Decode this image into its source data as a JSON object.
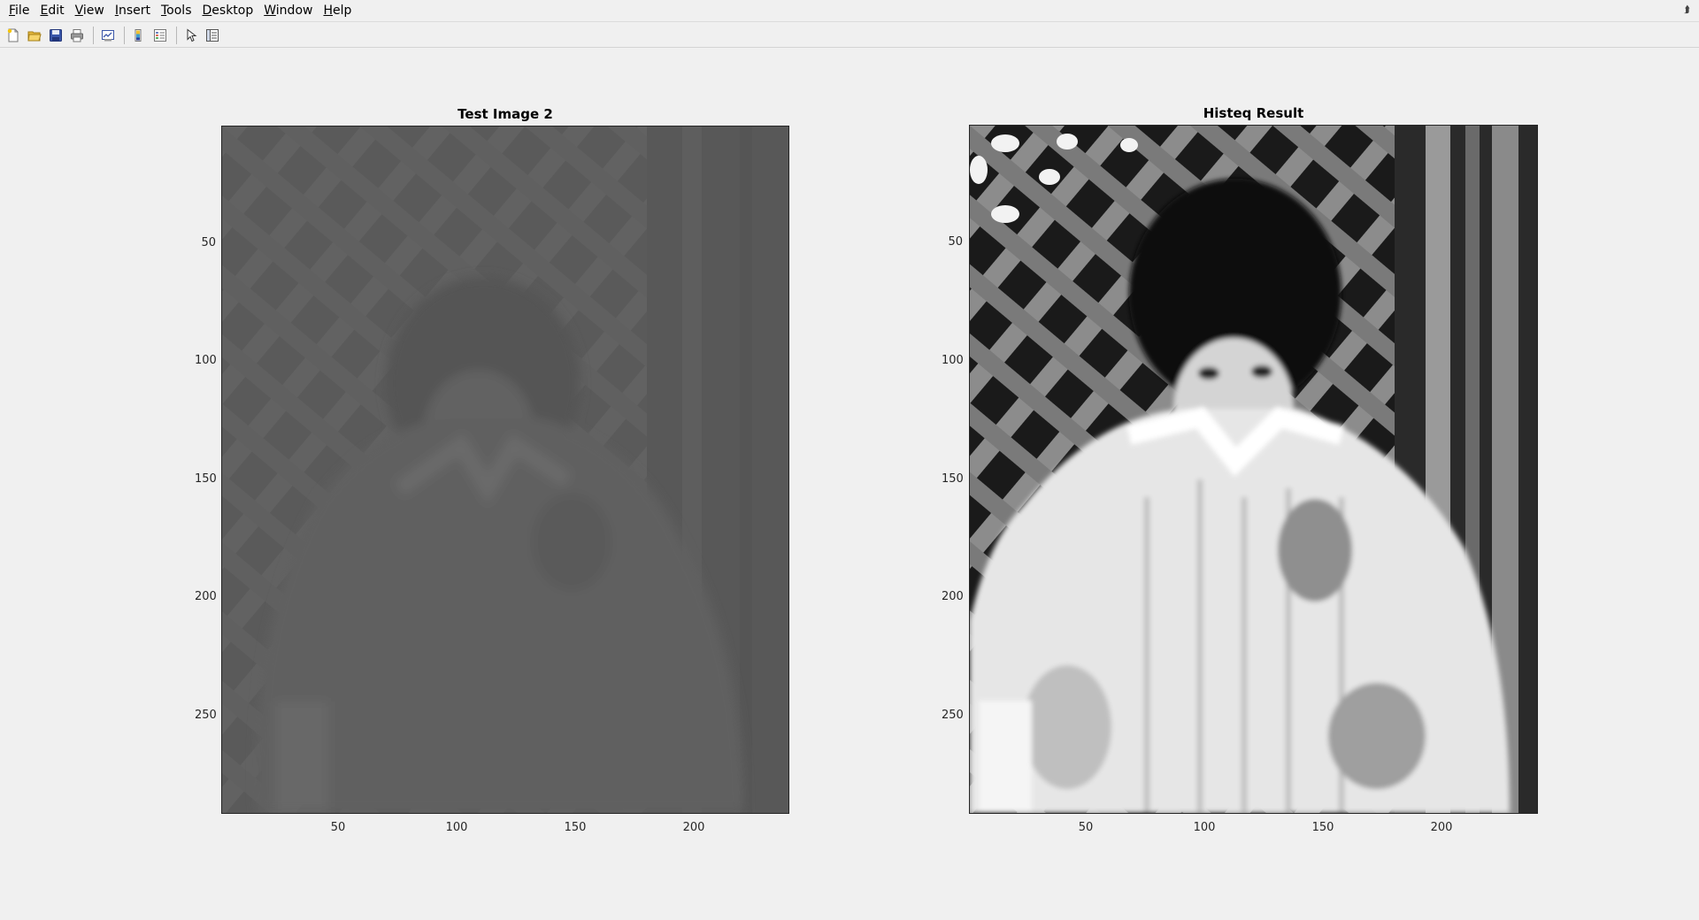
{
  "menu": {
    "items": [
      {
        "label": "File",
        "mnemonic": "F",
        "rest": "ile"
      },
      {
        "label": "Edit",
        "mnemonic": "E",
        "rest": "dit"
      },
      {
        "label": "View",
        "mnemonic": "V",
        "rest": "iew"
      },
      {
        "label": "Insert",
        "mnemonic": "I",
        "rest": "nsert"
      },
      {
        "label": "Tools",
        "mnemonic": "T",
        "rest": "ools"
      },
      {
        "label": "Desktop",
        "mnemonic": "D",
        "rest": "esktop"
      },
      {
        "label": "Window",
        "mnemonic": "W",
        "rest": "indow"
      },
      {
        "label": "Help",
        "mnemonic": "H",
        "rest": "elp"
      }
    ]
  },
  "toolbar": {
    "icons": [
      "new-figure-icon",
      "open-file-icon",
      "save-icon",
      "print-icon",
      "link-plot-icon",
      "colorbar-icon",
      "legend-icon",
      "edit-plot-icon",
      "property-inspector-icon"
    ]
  },
  "axes": [
    {
      "title": "Test Image 2",
      "x_ticks": [
        "50",
        "100",
        "150",
        "200"
      ],
      "y_ticks": [
        "50",
        "100",
        "150",
        "200",
        "250"
      ],
      "image": "low-contrast grayscale photo of child in coat in front of lattice"
    },
    {
      "title": "Histeq Result",
      "x_ticks": [
        "50",
        "100",
        "150",
        "200"
      ],
      "y_ticks": [
        "50",
        "100",
        "150",
        "200",
        "250"
      ],
      "image": "histogram-equalized high-contrast grayscale photo of child in coat in front of lattice"
    }
  ],
  "colors": {
    "figure_bg": "#f0f0f0",
    "axes_line": "#262626"
  }
}
